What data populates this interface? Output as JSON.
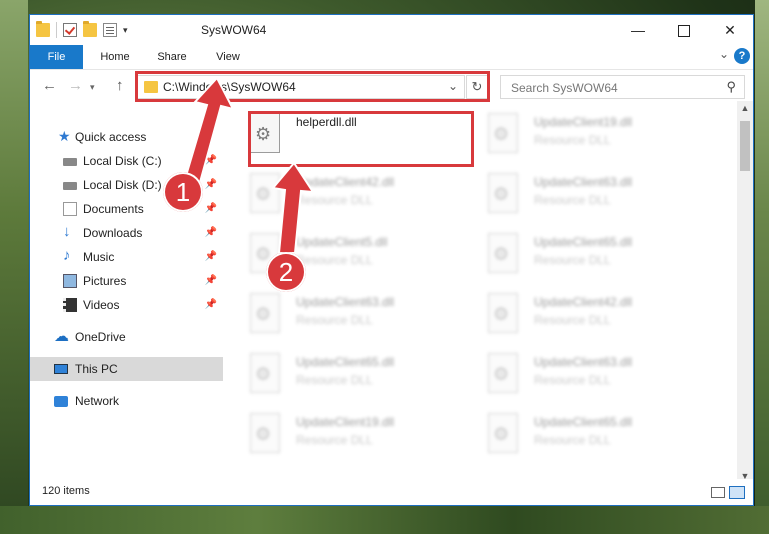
{
  "window": {
    "title": "SysWOW64",
    "controls": {
      "minimize": "—",
      "maximize": "",
      "close": "✕"
    }
  },
  "ribbon": {
    "tabs": [
      "File",
      "Home",
      "Share",
      "View"
    ],
    "collapse_icon": "chevron-down-icon",
    "help_label": "?"
  },
  "address_bar": {
    "path": "C:\\Windows\\SysWOW64",
    "dropdown_glyph": "⌄",
    "refresh_glyph": "↻"
  },
  "search": {
    "placeholder": "Search SysWOW64",
    "icon_glyph": "⚲"
  },
  "nav_glyphs": {
    "back": "←",
    "forward": "→",
    "history": "▾",
    "up": "↑"
  },
  "nav_pane": {
    "items": [
      {
        "label": "Quick access",
        "icon": "star-icon",
        "glyph": "★"
      },
      {
        "label": "Local Disk (C:)",
        "icon": "drive-icon",
        "pinned": true
      },
      {
        "label": "Local Disk (D:)",
        "icon": "drive-icon",
        "pinned": true
      },
      {
        "label": "Documents",
        "icon": "documents-icon",
        "pinned": true
      },
      {
        "label": "Downloads",
        "icon": "download-arrow-icon",
        "glyph": "↓",
        "pinned": true
      },
      {
        "label": "Music",
        "icon": "music-note-icon",
        "glyph": "♪",
        "pinned": true
      },
      {
        "label": "Pictures",
        "icon": "pictures-icon",
        "pinned": true
      },
      {
        "label": "Videos",
        "icon": "film-icon",
        "pinned": true
      },
      {
        "label": "OneDrive",
        "icon": "cloud-icon",
        "glyph": "☁"
      },
      {
        "label": "This PC",
        "icon": "computer-icon",
        "selected": true
      },
      {
        "label": "Network",
        "icon": "network-icon"
      }
    ],
    "pin_glyph": "📌"
  },
  "files": [
    {
      "name": "helperdll.dll",
      "type": "",
      "blurred": false
    },
    {
      "name": "UpdateClient19.dll",
      "type": "Resource DLL",
      "blurred": true
    },
    {
      "name": "UpdateClient42.dll",
      "type": "Resource DLL",
      "blurred": true
    },
    {
      "name": "UpdateClient63.dll",
      "type": "Resource DLL",
      "blurred": true
    },
    {
      "name": "UpdateClient5.dll",
      "type": "Resource DLL",
      "blurred": true
    },
    {
      "name": "UpdateClient65.dll",
      "type": "Resource DLL",
      "blurred": true
    },
    {
      "name": "UpdateClient63.dll",
      "type": "Resource DLL",
      "blurred": true
    },
    {
      "name": "UpdateClient42.dll",
      "type": "Resource DLL",
      "blurred": true
    },
    {
      "name": "UpdateClient65.dll",
      "type": "Resource DLL",
      "blurred": true
    },
    {
      "name": "UpdateClient63.dll",
      "type": "Resource DLL",
      "blurred": true
    },
    {
      "name": "UpdateClient19.dll",
      "type": "Resource DLL",
      "blurred": true
    },
    {
      "name": "UpdateClient65.dll",
      "type": "Resource DLL",
      "blurred": true
    }
  ],
  "status_bar": {
    "item_count": "120 items"
  },
  "scrollbar_glyphs": {
    "up": "▲",
    "down": "▼"
  },
  "annotations": {
    "callout_1": "1",
    "callout_2": "2",
    "color": "#d8393c"
  }
}
